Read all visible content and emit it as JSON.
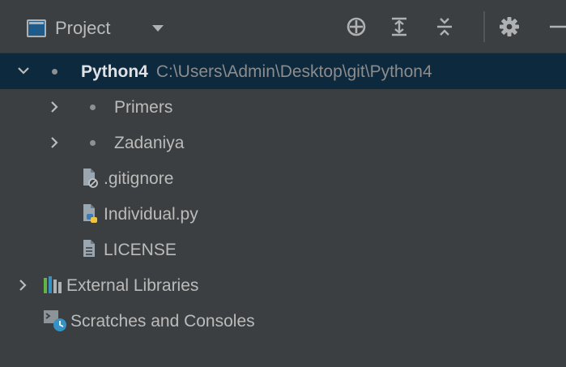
{
  "header": {
    "title": "Project",
    "view_icon": "project-view-icon",
    "dropdown_icon": "chevron-down-icon",
    "toolbar": [
      {
        "name": "select-opened-file-icon"
      },
      {
        "name": "expand-all-icon"
      },
      {
        "name": "collapse-all-icon"
      },
      {
        "name": "gear-icon"
      },
      {
        "name": "hide-icon"
      }
    ]
  },
  "tree": {
    "root": {
      "name": "Python4",
      "path": "C:\\Users\\Admin\\Desktop\\git\\Python4",
      "expanded": true
    },
    "children": [
      {
        "label": "Primers",
        "type": "folder",
        "expanded": false
      },
      {
        "label": "Zadaniya",
        "type": "folder",
        "expanded": false
      },
      {
        "label": ".gitignore",
        "type": "ignored-file"
      },
      {
        "label": "Individual.py",
        "type": "python-file",
        "color": "#c75450"
      },
      {
        "label": "LICENSE",
        "type": "text-file"
      }
    ],
    "external_libraries": "External Libraries",
    "scratches": "Scratches and Consoles"
  },
  "colors": {
    "background": "#3c3f41",
    "selection": "#0d293e",
    "text": "#bbbbbb",
    "path_text": "#8c8c8c",
    "modified_file": "#c75450"
  }
}
